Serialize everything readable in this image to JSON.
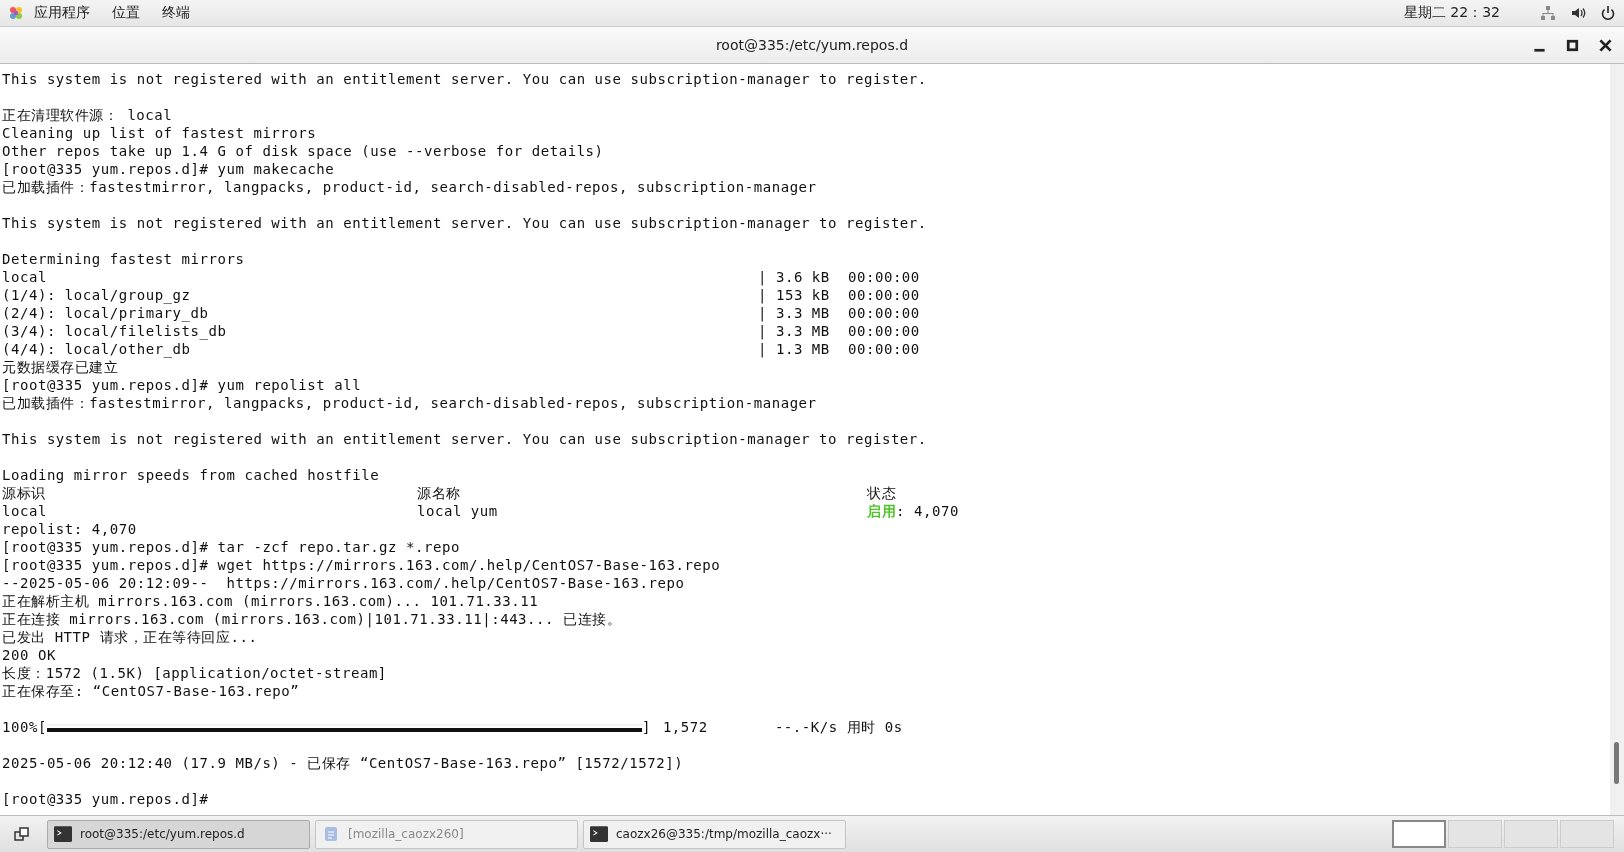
{
  "top_bar": {
    "menus": [
      "应用程序",
      "位置",
      "终端"
    ],
    "clock": "星期二 22：32"
  },
  "window": {
    "title": "root@335:/etc/yum.repos.d"
  },
  "terminal": {
    "lines": [
      {
        "kind": "text",
        "text": "This system is not registered with an entitlement server. You can use subscription-manager to register."
      },
      {
        "kind": "blank"
      },
      {
        "kind": "text",
        "text": "正在清理软件源： local"
      },
      {
        "kind": "text",
        "text": "Cleaning up list of fastest mirrors"
      },
      {
        "kind": "text",
        "text": "Other repos take up 1.4 G of disk space (use --verbose for details)"
      },
      {
        "kind": "text",
        "text": "[root@335 yum.repos.d]# yum makecache"
      },
      {
        "kind": "text",
        "text": "已加载插件：fastestmirror, langpacks, product-id, search-disabled-repos, subscription-manager"
      },
      {
        "kind": "blank"
      },
      {
        "kind": "text",
        "text": "This system is not registered with an entitlement server. You can use subscription-manager to register."
      },
      {
        "kind": "blank"
      },
      {
        "kind": "text",
        "text": "Determining fastest mirrors"
      },
      {
        "kind": "transfer",
        "name": "local",
        "size": "| 3.6 kB",
        "time": "00:00:00"
      },
      {
        "kind": "transfer",
        "name": "(1/4): local/group_gz",
        "size": "| 153 kB",
        "time": "00:00:00"
      },
      {
        "kind": "transfer",
        "name": "(2/4): local/primary_db",
        "size": "| 3.3 MB",
        "time": "00:00:00"
      },
      {
        "kind": "transfer",
        "name": "(3/4): local/filelists_db",
        "size": "| 3.3 MB",
        "time": "00:00:00"
      },
      {
        "kind": "transfer",
        "name": "(4/4): local/other_db",
        "size": "| 1.3 MB",
        "time": "00:00:00"
      },
      {
        "kind": "text",
        "text": "元数据缓存已建立"
      },
      {
        "kind": "text",
        "text": "[root@335 yum.repos.d]# yum repolist all"
      },
      {
        "kind": "text",
        "text": "已加载插件：fastestmirror, langpacks, product-id, search-disabled-repos, subscription-manager"
      },
      {
        "kind": "blank"
      },
      {
        "kind": "text",
        "text": "This system is not registered with an entitlement server. You can use subscription-manager to register."
      },
      {
        "kind": "blank"
      },
      {
        "kind": "text",
        "text": "Loading mirror speeds from cached hostfile"
      },
      {
        "kind": "repo",
        "id": "源标识",
        "name": "源名称",
        "status": "状态"
      },
      {
        "kind": "repo",
        "id": "local",
        "name": "local yum",
        "status_label": "启用",
        "color": "#4fc42a",
        "status": ": 4,070"
      },
      {
        "kind": "text",
        "text": "repolist: 4,070"
      },
      {
        "kind": "text",
        "text": "[root@335 yum.repos.d]# tar -zcf repo.tar.gz *.repo"
      },
      {
        "kind": "text",
        "text": "[root@335 yum.repos.d]# wget https://mirrors.163.com/.help/CentOS7-Base-163.repo"
      },
      {
        "kind": "text",
        "text": "--2025-05-06 20:12:09--  https://mirrors.163.com/.help/CentOS7-Base-163.repo"
      },
      {
        "kind": "text",
        "text": "正在解析主机 mirrors.163.com (mirrors.163.com)... 101.71.33.11"
      },
      {
        "kind": "text",
        "text": "正在连接 mirrors.163.com (mirrors.163.com)|101.71.33.11|:443... 已连接。"
      },
      {
        "kind": "text",
        "text": "已发出 HTTP 请求，正在等待回应..."
      },
      {
        "kind": "text",
        "text": "200 OK"
      },
      {
        "kind": "text",
        "text": "长度：1572 (1.5K) [application/octet-stream]"
      },
      {
        "kind": "text",
        "text": "正在保存至: “CentOS7-Base-163.repo”"
      },
      {
        "kind": "blank"
      },
      {
        "kind": "progress",
        "percent": "100%[",
        "level": 1,
        "end": "]",
        "size": "1,572",
        "speed": "--.-K/s 用时 0s"
      },
      {
        "kind": "blank"
      },
      {
        "kind": "text",
        "text": "2025-05-06 20:12:40 (17.9 MB/s) - 已保存 “CentOS7-Base-163.repo” [1572/1572])"
      },
      {
        "kind": "blank"
      },
      {
        "kind": "text",
        "text": "[root@335 yum.repos.d]#"
      }
    ]
  },
  "taskbar": {
    "tasks": [
      {
        "label": "root@335:/etc/yum.repos.d",
        "kind": "terminal",
        "selected": true
      },
      {
        "label": "[mozilla_caozx260]",
        "kind": "file",
        "selected": false
      },
      {
        "label": "caozx26@335:/tmp/mozilla_caozx···",
        "kind": "terminal",
        "selected": false
      }
    ],
    "workspaces": [
      {
        "selected": true
      },
      {
        "selected": false
      },
      {
        "selected": false
      },
      {
        "selected": false
      }
    ]
  }
}
